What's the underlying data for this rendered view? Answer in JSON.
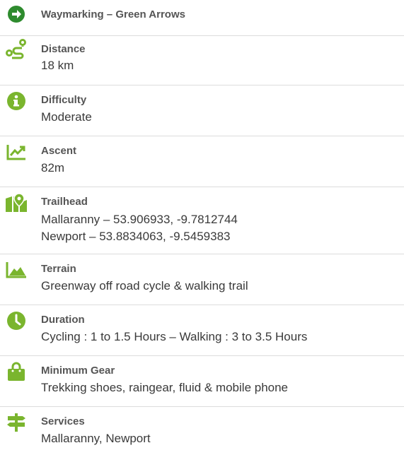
{
  "colors": {
    "accent": "#7ab52e",
    "arrow_circle": "#2e8b2e",
    "divider": "#dcdcdc"
  },
  "items": [
    {
      "icon": "arrow-right-circle-icon",
      "title": "Waymarking – Green Arrows"
    },
    {
      "icon": "route-icon",
      "title": "Distance",
      "value": "18 km"
    },
    {
      "icon": "info-icon",
      "title": "Difficulty",
      "value": "Moderate"
    },
    {
      "icon": "chart-line-icon",
      "title": "Ascent",
      "value": "82m"
    },
    {
      "icon": "map-marker-icon",
      "title": "Trailhead",
      "values": [
        "Mallaranny – 53.906933, -9.7812744",
        "Newport – 53.8834063, -9.5459383"
      ]
    },
    {
      "icon": "mountain-icon",
      "title": "Terrain",
      "value": "Greenway off road cycle & walking trail"
    },
    {
      "icon": "clock-icon",
      "title": "Duration",
      "value": "Cycling : 1 to 1.5 Hours – Walking : 3 to 3.5 Hours"
    },
    {
      "icon": "shopping-bag-icon",
      "title": "Minimum Gear",
      "value": "Trekking shoes, raingear, fluid & mobile phone"
    },
    {
      "icon": "signpost-icon",
      "title": "Services",
      "value": "Mallaranny, Newport"
    }
  ]
}
